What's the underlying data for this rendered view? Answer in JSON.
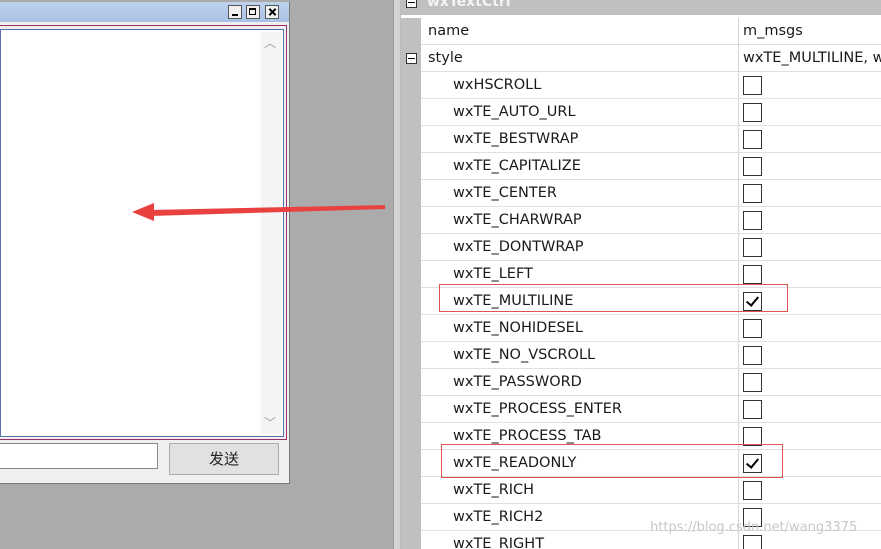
{
  "preview": {
    "send_label": "发送"
  },
  "grid": {
    "category": "wxTextCtrl",
    "rows": [
      {
        "name": "name",
        "value": "m_msgs"
      },
      {
        "name": "style",
        "value": "wxTE_MULTILINE, w"
      }
    ],
    "style_flags": [
      {
        "name": "wxHSCROLL",
        "checked": false
      },
      {
        "name": "wxTE_AUTO_URL",
        "checked": false
      },
      {
        "name": "wxTE_BESTWRAP",
        "checked": false
      },
      {
        "name": "wxTE_CAPITALIZE",
        "checked": false
      },
      {
        "name": "wxTE_CENTER",
        "checked": false
      },
      {
        "name": "wxTE_CHARWRAP",
        "checked": false
      },
      {
        "name": "wxTE_DONTWRAP",
        "checked": false
      },
      {
        "name": "wxTE_LEFT",
        "checked": false
      },
      {
        "name": "wxTE_MULTILINE",
        "checked": true
      },
      {
        "name": "wxTE_NOHIDESEL",
        "checked": false
      },
      {
        "name": "wxTE_NO_VSCROLL",
        "checked": false
      },
      {
        "name": "wxTE_PASSWORD",
        "checked": false
      },
      {
        "name": "wxTE_PROCESS_ENTER",
        "checked": false
      },
      {
        "name": "wxTE_PROCESS_TAB",
        "checked": false
      },
      {
        "name": "wxTE_READONLY",
        "checked": true
      },
      {
        "name": "wxTE_RICH",
        "checked": false
      },
      {
        "name": "wxTE_RICH2",
        "checked": false
      },
      {
        "name": "wxTE_RIGHT",
        "checked": false
      }
    ]
  },
  "watermark": "https://blog.csdn.net/wang3375",
  "colors": {
    "annotation_red": "#e8413f",
    "highlight_red": "#e0524f"
  }
}
